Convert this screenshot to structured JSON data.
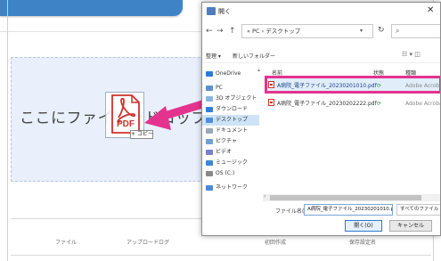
{
  "page": {
    "dropzone_text": "ここにファイルをドロップ",
    "table_headers": [
      "ファイル",
      "アップロードログ",
      "初回作成",
      "保存設定名"
    ]
  },
  "drag": {
    "icon_label": "PDF",
    "copy_badge": "+ コピー",
    "arrow_color": "#e4338f"
  },
  "dialog": {
    "title": "開く",
    "close_icon": "✕",
    "nav": {
      "back": "←",
      "forward": "→",
      "up": "↑"
    },
    "address": {
      "parts": [
        "PC",
        "デスクトップ"
      ],
      "separator": "›",
      "text": "« PC › デスクトップ"
    },
    "search_placeholder": "",
    "toolbar": {
      "organize": "整理 ▾",
      "new_folder": "新しいフォルダー",
      "view_icons": "☷ ▾  ◫"
    },
    "help_icon": "?",
    "nav_pane": [
      {
        "label": "OneDrive",
        "icon": "cloud-icon",
        "color": "#2a7bd6"
      },
      {
        "label": "PC",
        "icon": "pc-icon",
        "color": "#5b8fd1"
      },
      {
        "label": "3D オブジェクト",
        "icon": "cube-icon",
        "color": "#8ab4e6"
      },
      {
        "label": "ダウンロード",
        "icon": "download-icon",
        "color": "#2f7ed8"
      },
      {
        "label": "デスクトップ",
        "icon": "desktop-icon",
        "color": "#4c8ee0",
        "selected": true
      },
      {
        "label": "ドキュメント",
        "icon": "document-icon",
        "color": "#9aa8b8"
      },
      {
        "label": "ピクチャ",
        "icon": "picture-icon",
        "color": "#6fa0d8"
      },
      {
        "label": "ビデオ",
        "icon": "video-icon",
        "color": "#7a7fcf"
      },
      {
        "label": "ミュージック",
        "icon": "music-icon",
        "color": "#3d86d6"
      },
      {
        "label": "OS (C:)",
        "icon": "drive-icon",
        "color": "#8a8a8a"
      },
      {
        "label": "ネットワーク",
        "icon": "network-icon",
        "color": "#4a8ad4"
      }
    ],
    "columns": {
      "name": "名前",
      "status": "状態",
      "type": "種類"
    },
    "files": [
      {
        "name": "A病院_電子ファイル_20230201010.pdf",
        "status": "⟳",
        "type": "Adobe Acrobat 文書",
        "highlighted": true
      },
      {
        "name": "A病院_電子ファイル_20230202222.pdf",
        "status": "⟳",
        "type": "Adobe Acrobat 文書",
        "highlighted": false
      }
    ],
    "filename_label": "ファイル名(N):",
    "filename_value": "A病院_電子ファイル_20230201010.pdf",
    "filetype_value": "すべてのファイル (*.*)",
    "open_button": "開く(O)",
    "cancel_button": "キャンセル"
  }
}
